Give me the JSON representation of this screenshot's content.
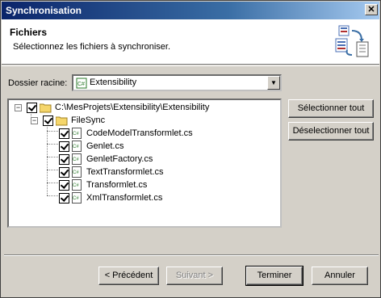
{
  "window": {
    "title": "Synchronisation",
    "close_glyph": "✕"
  },
  "header": {
    "title": "Fichiers",
    "subtitle": "Sélectionnez les fichiers à synchroniser.",
    "icon": "sync-files-icon"
  },
  "root_folder": {
    "label": "Dossier racine:",
    "value": "Extensibility",
    "icon": "cs-project-icon"
  },
  "tree": {
    "root": {
      "label": "C:\\MesProjets\\Extensibility\\Extensibility",
      "checked": true,
      "expanded": true
    },
    "folder": {
      "label": "FileSync",
      "checked": true,
      "expanded": true
    },
    "files": [
      {
        "label": "CodeModelTransformlet.cs",
        "checked": true
      },
      {
        "label": "Genlet.cs",
        "checked": true
      },
      {
        "label": "GenletFactory.cs",
        "checked": true
      },
      {
        "label": "TextTransformlet.cs",
        "checked": true
      },
      {
        "label": "Transformlet.cs",
        "checked": true
      },
      {
        "label": "XmlTransformlet.cs",
        "checked": true
      }
    ]
  },
  "side_buttons": {
    "select_all": "Sélectionner tout",
    "deselect_all": "Déselectionner tout"
  },
  "footer_buttons": {
    "previous": "< Précédent",
    "next": "Suivant >",
    "finish": "Terminer",
    "cancel": "Annuler"
  },
  "colors": {
    "title_start": "#0a246a",
    "title_end": "#a6caf0",
    "face": "#d4d0c8"
  }
}
